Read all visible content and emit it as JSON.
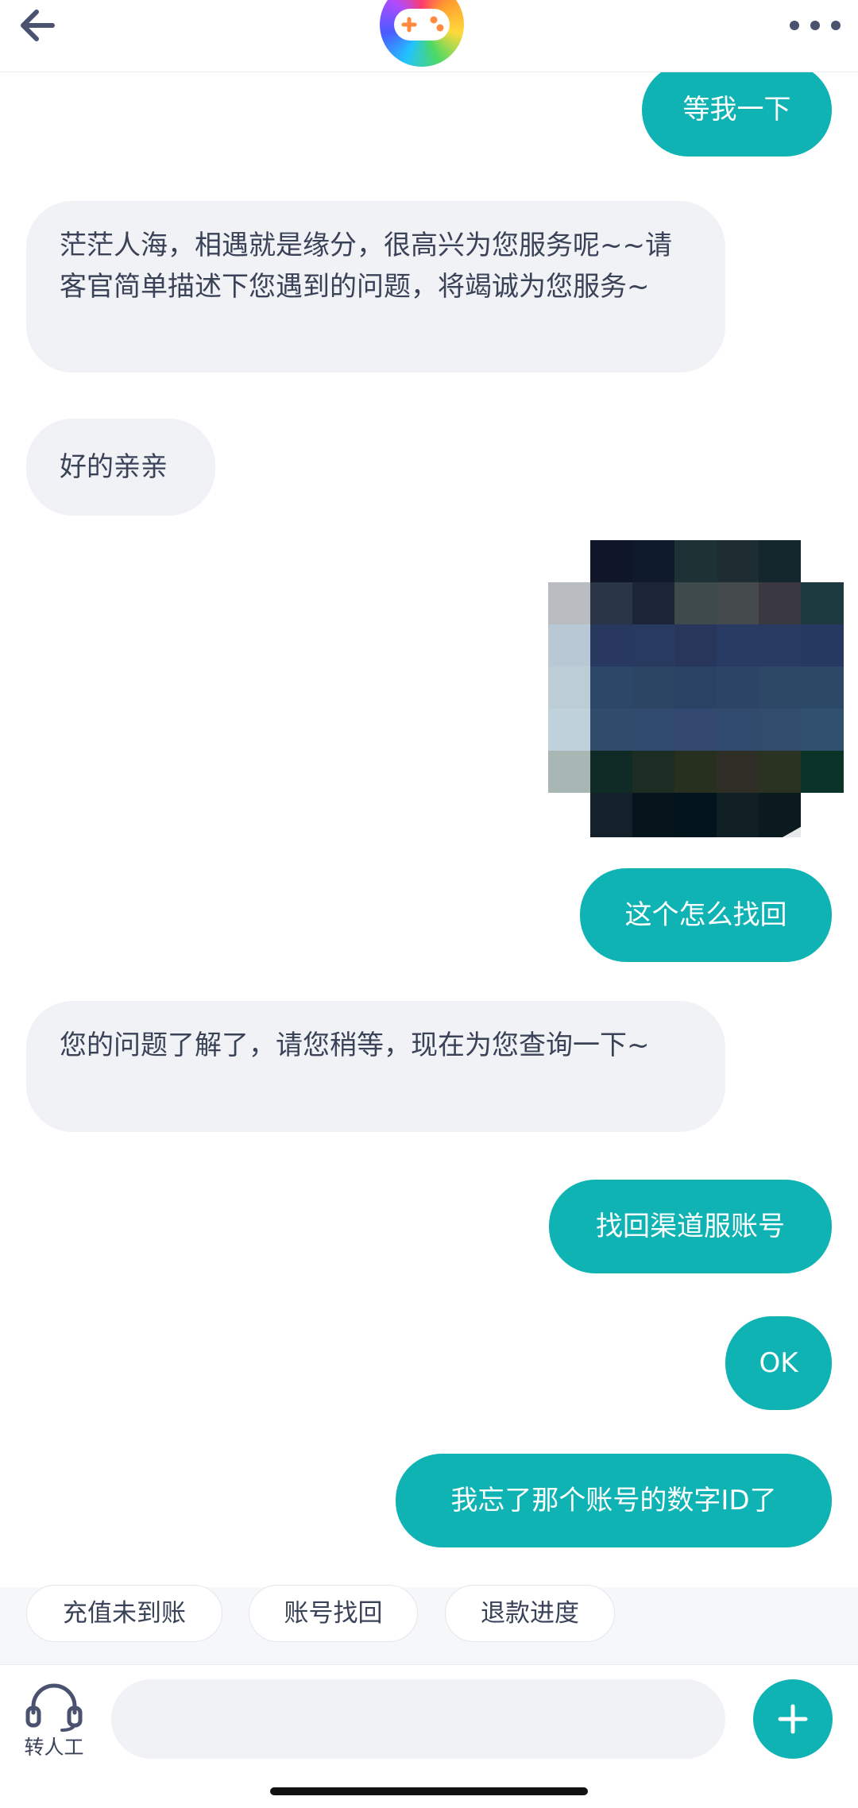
{
  "header": {
    "back_icon": "arrow-left-icon",
    "logo_icon": "gamepad-icon",
    "more_icon": "more-dots-icon"
  },
  "messages": [
    {
      "from": "me",
      "text": "等我一下"
    },
    {
      "from": "bot",
      "text": "茫茫人海，相遇就是缘分，很高兴为您服务呢~~请客官简单描述下您遇到的问题，将竭诚为您服务~"
    },
    {
      "from": "bot",
      "text": "好的亲亲"
    },
    {
      "from": "me",
      "type": "image",
      "image": "pixelated-screenshot"
    },
    {
      "from": "me",
      "text": "这个怎么找回"
    },
    {
      "from": "bot",
      "text": "您的问题了解了，请您稍等，现在为您查询一下~"
    },
    {
      "from": "me",
      "text": "找回渠道服账号"
    },
    {
      "from": "me",
      "text": "OK"
    },
    {
      "from": "me",
      "text": "我忘了那个账号的数字ID了"
    }
  ],
  "quick_replies": [
    "充值未到账",
    "账号找回",
    "退款进度"
  ],
  "bottom": {
    "agent_label": "转人工",
    "agent_icon": "headset-icon",
    "input_value": "",
    "input_placeholder": "",
    "plus_icon": "plus-icon"
  },
  "colors": {
    "accent": "#0fb3b3",
    "bot_bubble": "#f0f2f5",
    "text": "#3a4258"
  }
}
